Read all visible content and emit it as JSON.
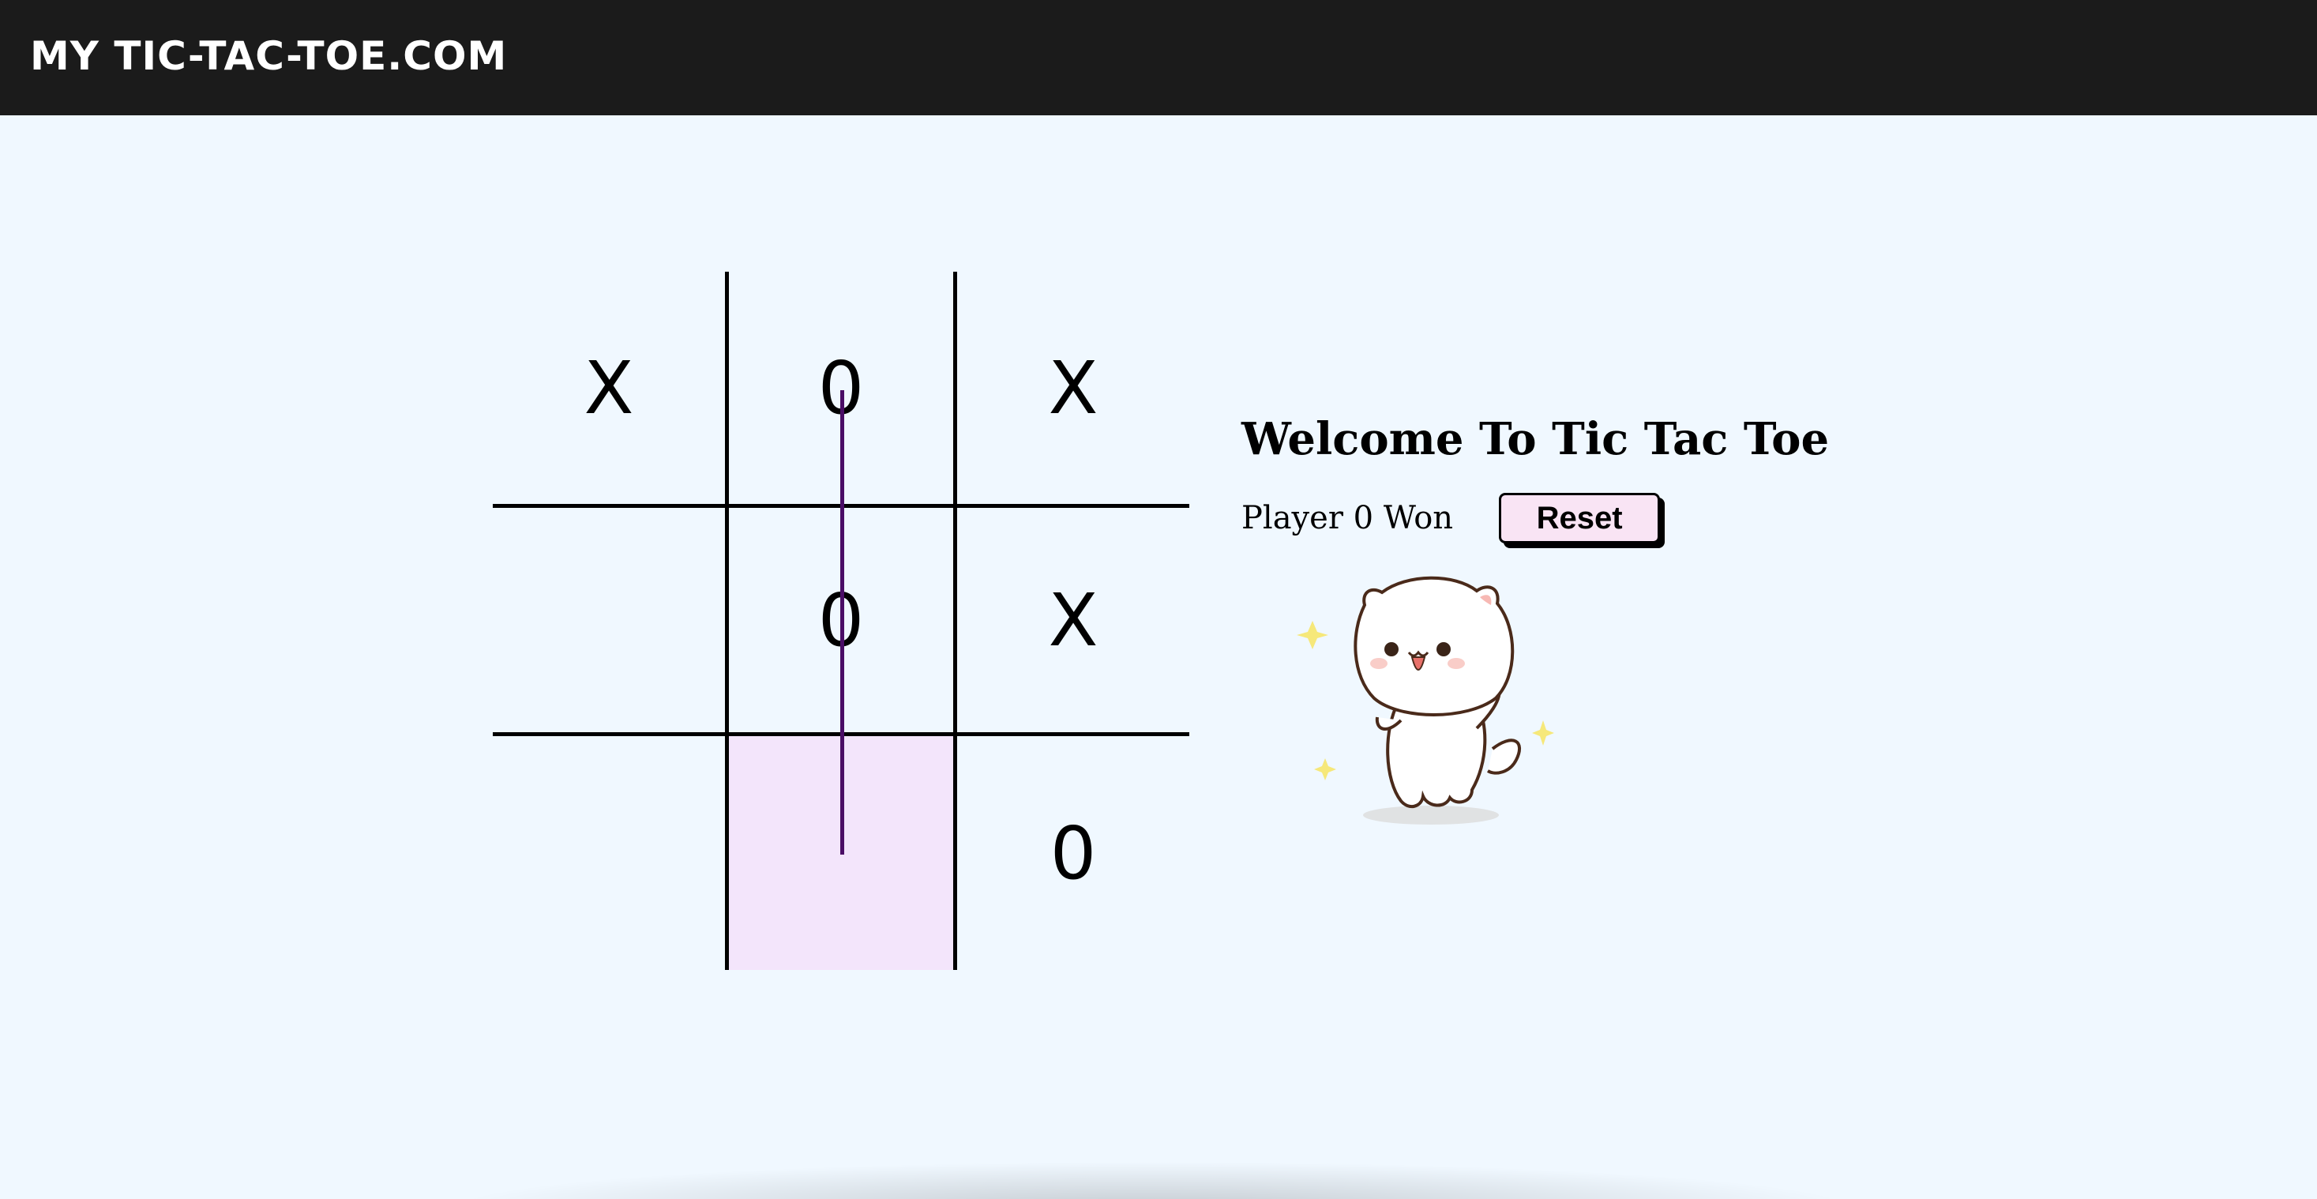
{
  "navbar": {
    "brand": "MY TIC-TAC-TOE.COM"
  },
  "board": {
    "cells": [
      "X",
      "0",
      "X",
      "",
      "0",
      "X",
      "",
      "",
      "0"
    ],
    "winning_cells": [
      1,
      4,
      7
    ]
  },
  "info": {
    "title": "Welcome To Tic Tac Toe",
    "status": "Player 0 Won",
    "reset_label": "Reset"
  },
  "colors": {
    "navbar": "#1b1b1b",
    "background": "#f0f8ff",
    "win_highlight": "#f3e5fb",
    "win_line": "#4a0d66",
    "reset_bg": "#f9e4f4"
  },
  "image": {
    "icon": "dancing-cat-icon"
  }
}
